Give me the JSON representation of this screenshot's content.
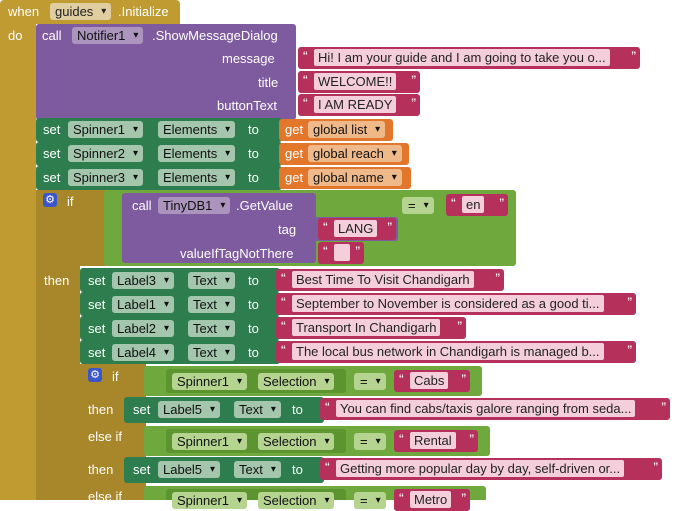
{
  "event": {
    "when": "when",
    "component": "guides",
    "event_name": ".Initialize",
    "do": "do"
  },
  "notifier": {
    "call": "call",
    "component": "Notifier1",
    "method": ".ShowMessageDialog",
    "params": [
      {
        "name": "message",
        "value": "Hi! I am your guide and I am going to take you o..."
      },
      {
        "name": "title",
        "value": "WELCOME!!"
      },
      {
        "name": "buttonText",
        "value": "I AM READY"
      }
    ]
  },
  "set_spinners": [
    {
      "set": "set",
      "component": "Spinner1",
      "prop": "Elements",
      "to": "to",
      "get": "get",
      "var": "global list"
    },
    {
      "set": "set",
      "component": "Spinner2",
      "prop": "Elements",
      "to": "to",
      "get": "get",
      "var": "global reach"
    },
    {
      "set": "set",
      "component": "Spinner3",
      "prop": "Elements",
      "to": "to",
      "get": "get",
      "var": "global name"
    }
  ],
  "if_block": {
    "if": "if",
    "then": "then",
    "call": "call",
    "component": "TinyDB1",
    "method": ".GetValue",
    "tag_label": "tag",
    "tag_value": "LANG",
    "vitn_label": "valueIfTagNotThere",
    "vitn_value": "",
    "op": "=",
    "compare": "en"
  },
  "set_labels": [
    {
      "set": "set",
      "component": "Label3",
      "prop": "Text",
      "to": "to",
      "value": "Best Time To Visit Chandigarh"
    },
    {
      "set": "set",
      "component": "Label1",
      "prop": "Text",
      "to": "to",
      "value": "September to November is considered as a good ti..."
    },
    {
      "set": "set",
      "component": "Label2",
      "prop": "Text",
      "to": "to",
      "value": "Transport In Chandigarh"
    },
    {
      "set": "set",
      "component": "Label4",
      "prop": "Text",
      "to": "to",
      "value": "The local bus network in Chandigarh is managed b..."
    }
  ],
  "inner_if": {
    "if": "if",
    "then": "then",
    "else_if": "else if",
    "branches": [
      {
        "component": "Spinner1",
        "prop": "Selection",
        "op": "=",
        "compare": "Cabs",
        "set": "set",
        "target": "Label5",
        "target_prop": "Text",
        "to": "to",
        "value": "You can find cabs/taxis galore ranging from seda..."
      },
      {
        "component": "Spinner1",
        "prop": "Selection",
        "op": "=",
        "compare": "Rental",
        "set": "set",
        "target": "Label5",
        "target_prop": "Text",
        "to": "to",
        "value": "Getting more popular day by day, self-driven or..."
      },
      {
        "component": "Spinner1",
        "prop": "Selection",
        "op": "=",
        "compare": "Metro"
      }
    ]
  }
}
